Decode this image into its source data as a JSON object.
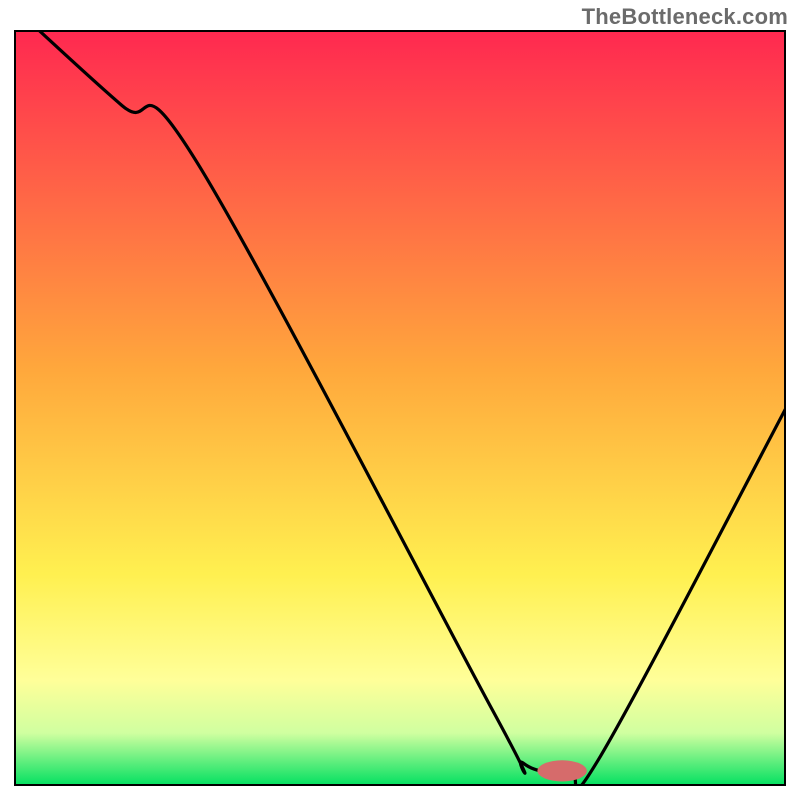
{
  "watermark": "TheBottleneck.com",
  "chart_data": {
    "type": "line",
    "title": "",
    "xlabel": "",
    "ylabel": "",
    "xlim": [
      0,
      100
    ],
    "ylim": [
      0,
      100
    ],
    "grid": false,
    "axis_ticks_visible": false,
    "legend": false,
    "gradient_stops": [
      {
        "offset": 0.0,
        "color": "#ff2850"
      },
      {
        "offset": 0.45,
        "color": "#ffa83c"
      },
      {
        "offset": 0.72,
        "color": "#fff050"
      },
      {
        "offset": 0.86,
        "color": "#ffff99"
      },
      {
        "offset": 0.93,
        "color": "#d0ffa0"
      },
      {
        "offset": 1.0,
        "color": "#00e060"
      }
    ],
    "series": [
      {
        "name": "bottleneck-curve",
        "color": "#000000",
        "x": [
          0,
          14,
          24,
          62,
          66,
          72,
          76,
          100
        ],
        "values": [
          103,
          90,
          82,
          10,
          3,
          2,
          4,
          50
        ]
      }
    ],
    "marker": {
      "name": "optimal-marker",
      "cx": 71,
      "cy": 2,
      "rx": 3.2,
      "ry": 1.4,
      "color": "#d66b6b"
    },
    "frame_color": "#000000",
    "frame_stroke_width_px": 4
  }
}
